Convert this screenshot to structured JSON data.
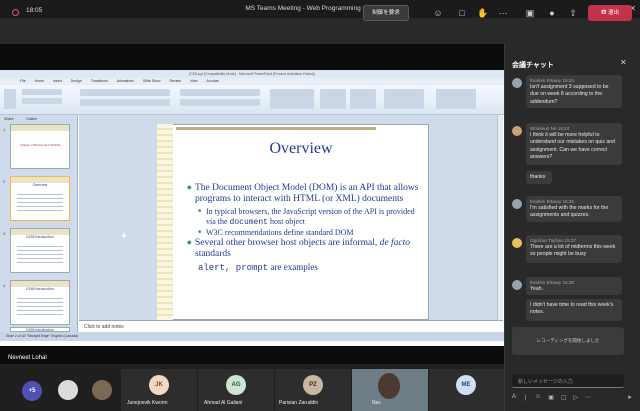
{
  "window": {
    "title": "MS Teams Meeting - Web Programming (WEB-222)"
  },
  "toolbar": {
    "timer": "18:05",
    "request_control": "制御を要求",
    "leave": "退出"
  },
  "presentation": {
    "app_title": "(CSS.ppt [Compatibility Mode] - Microsoft PowerPoint (Product Activation Failed))",
    "menu": [
      "File",
      "Home",
      "Insert",
      "Design",
      "Transitions",
      "Animations",
      "Slide Show",
      "Review",
      "View",
      "Acrobat"
    ],
    "panel_tabs": [
      "Slides",
      "Outline"
    ],
    "thumbs": [
      {
        "num": "1",
        "title": "Chapter 2 Behind and HCDCE"
      },
      {
        "num": "2",
        "title": "Overview"
      },
      {
        "num": "3",
        "title": "DOM Introduction"
      },
      {
        "num": "4",
        "title": "DOM Introduction"
      },
      {
        "num": "5",
        "title": "DOM Introduction"
      }
    ],
    "slide": {
      "title": "Overview",
      "bullet1": "The Document Object Model (DOM) is an API that allows programs to interact with HTML (or XML) documents",
      "sub1_pre": "In typical browsers, the JavaScript version of the API is provided via the ",
      "sub1_code": "document",
      "sub1_post": " host object",
      "sub2": "W3C recommendations define standard DOM",
      "bullet2_pre": "Several other browser host objects are informal, ",
      "bullet2_it": "de facto",
      "bullet2_post": " standards",
      "bullet3_code": "alert, prompt",
      "bullet3_post": " are examples"
    },
    "notes_placeholder": "Click to add notes",
    "status": "Slide 2 of 32   \"Straight Edge\"   English (Canada)"
  },
  "presenter": "Nevneet Lohal",
  "participants": {
    "overflow": "+5",
    "tiles": [
      {
        "initials": "JK",
        "name": "Junejoevik Kworm"
      },
      {
        "initials": "AG",
        "name": "Ahmad Al Galiani"
      },
      {
        "initials": "PZ",
        "name": "Parisian Zaruddin"
      },
      {
        "initials": "",
        "name": "Nav"
      },
      {
        "initials": "ME",
        "name": ""
      }
    ]
  },
  "chat": {
    "title": "会議チャット",
    "messages": [
      {
        "author": "Ibrahim Elsawy",
        "time": "15:24",
        "text": "Isn't assignment 3 supposed to be due on week 8 according to the addendum?"
      },
      {
        "author": "Wonkeun No",
        "time": "15:24",
        "text": "I think it will be more helpful to understand our mistakes on quiz and assignment. Can we have correct answers?"
      },
      {
        "author": "",
        "time": "",
        "text": "thanks"
      },
      {
        "author": "Ibrahim Elsawy",
        "time": "15:26",
        "text": "I'm satisfied with the marks for the assignments and quizzes."
      },
      {
        "author": "Ogulcan Tayhan",
        "time": "15:27",
        "text": "There are a lot of midterms this week so people might be busy"
      },
      {
        "author": "Ibrahim Elsawy",
        "time": "15:28",
        "text": "Yeah."
      },
      {
        "author": "",
        "time": "",
        "text": "I didn't have time to read this week's notes."
      }
    ],
    "recording_banner": "レコーディングを開始しました",
    "input_placeholder": "新しいメッセージの入力"
  },
  "colors": {
    "leave": "#c4314b",
    "slide_title": "#1f3a93",
    "ribbon": "#dbe6f3"
  }
}
